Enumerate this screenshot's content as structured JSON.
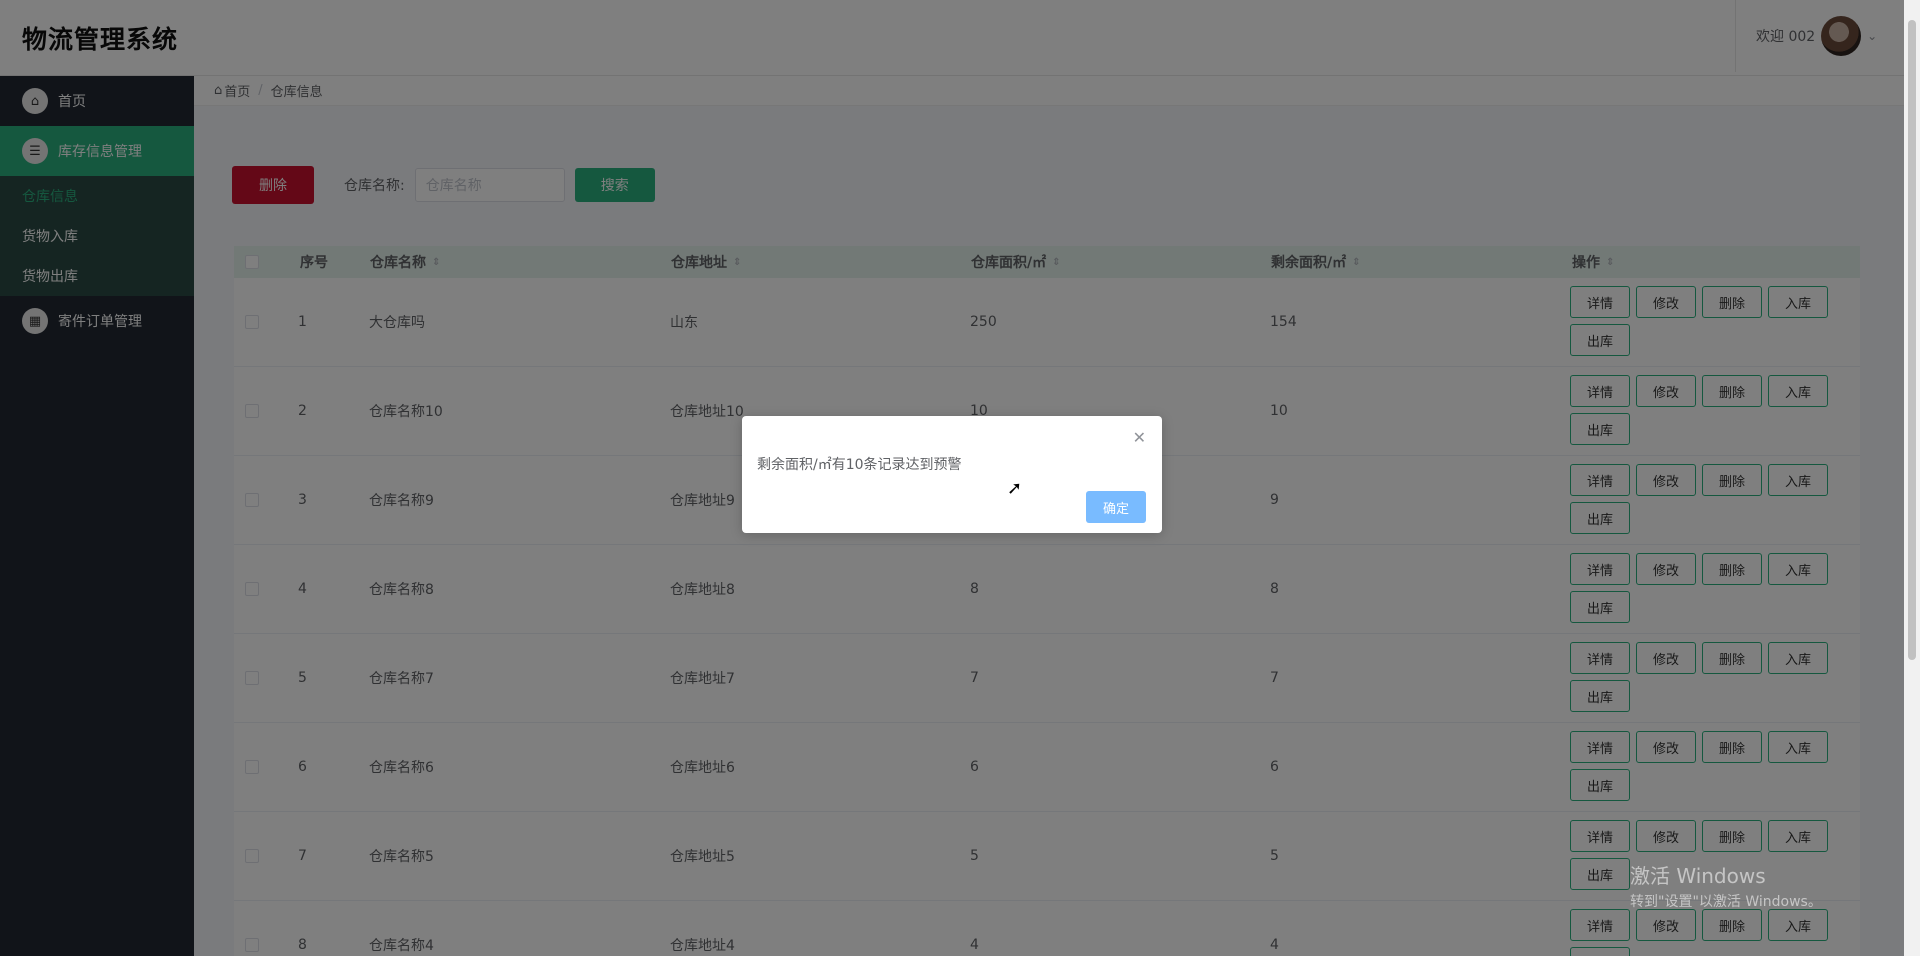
{
  "app": {
    "title": "物流管理系统",
    "welcome": "欢迎 002"
  },
  "sidebar": {
    "items": [
      {
        "label": "首页",
        "icon": "home-icon"
      },
      {
        "label": "库存信息管理",
        "icon": "list-icon",
        "children": [
          "仓库信息",
          "货物入库",
          "货物出库"
        ]
      },
      {
        "label": "寄件订单管理",
        "icon": "calendar-icon"
      }
    ]
  },
  "breadcrumb": {
    "home": "首页",
    "current": "仓库信息"
  },
  "toolbar": {
    "delete_label": "删除",
    "search_label": "仓库名称:",
    "search_placeholder": "仓库名称",
    "search_button": "搜索"
  },
  "table": {
    "headers": [
      "序号",
      "仓库名称",
      "仓库地址",
      "仓库面积/㎡",
      "剩余面积/㎡",
      "操作"
    ],
    "actions": [
      "详情",
      "修改",
      "删除",
      "入库",
      "出库"
    ],
    "rows": [
      {
        "no": "1",
        "name": "大仓库吗",
        "address": "山东",
        "area": "250",
        "remain": "154"
      },
      {
        "no": "2",
        "name": "仓库名称10",
        "address": "仓库地址10",
        "area": "10",
        "remain": "10"
      },
      {
        "no": "3",
        "name": "仓库名称9",
        "address": "仓库地址9",
        "area": "",
        "remain": "9"
      },
      {
        "no": "4",
        "name": "仓库名称8",
        "address": "仓库地址8",
        "area": "8",
        "remain": "8"
      },
      {
        "no": "5",
        "name": "仓库名称7",
        "address": "仓库地址7",
        "area": "7",
        "remain": "7"
      },
      {
        "no": "6",
        "name": "仓库名称6",
        "address": "仓库地址6",
        "area": "6",
        "remain": "6"
      },
      {
        "no": "7",
        "name": "仓库名称5",
        "address": "仓库地址5",
        "area": "5",
        "remain": "5"
      },
      {
        "no": "8",
        "name": "仓库名称4",
        "address": "仓库地址4",
        "area": "4",
        "remain": "4"
      }
    ]
  },
  "dialog": {
    "message": "剩余面积/㎡有10条记录达到预警",
    "confirm": "确定"
  },
  "watermark": {
    "line1": "激活 Windows",
    "line2": "转到\"设置\"以激活 Windows。"
  },
  "colors": {
    "accent": "#2bb07f",
    "danger": "#c8102e",
    "sidebar_bg": "#222933",
    "dialog_button": "#79bbff"
  }
}
